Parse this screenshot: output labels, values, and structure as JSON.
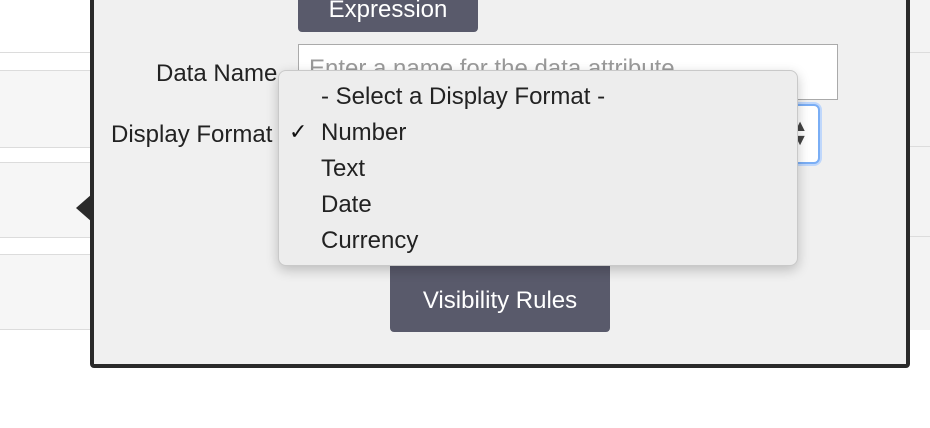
{
  "form": {
    "expression_button": "Expression",
    "data_name_label": "Data Name",
    "data_name_placeholder": "Enter a name for the data attribute",
    "display_format_label": "Display Format",
    "visibility_button": "Visibility Rules"
  },
  "dropdown": {
    "options": [
      {
        "label": "- Select a Display Format -",
        "checked": false
      },
      {
        "label": "Number",
        "checked": true
      },
      {
        "label": "Text",
        "checked": false
      },
      {
        "label": "Date",
        "checked": false
      },
      {
        "label": "Currency",
        "checked": false
      }
    ],
    "check_glyph": "✓"
  },
  "icons": {
    "select_arrows": "updown-arrows-icon"
  },
  "colors": {
    "button_bg": "#595a6b",
    "panel_border": "#2a2a2a",
    "focus_ring": "#7aaef5"
  }
}
